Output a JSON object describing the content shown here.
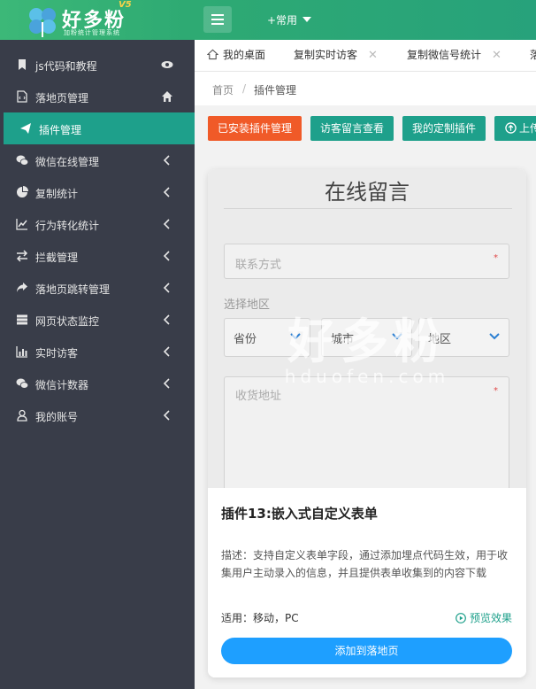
{
  "header": {
    "logo_title": "好多粉",
    "logo_version": "V5",
    "logo_subtitle": "加粉统计管理系统",
    "quick_menu": "+常用"
  },
  "sidebar": {
    "items": [
      {
        "label": "js代码和教程",
        "icon": "bookmark-icon",
        "right": "eye-icon"
      },
      {
        "label": "落地页管理",
        "icon": "code-file-icon",
        "right": "home-icon"
      },
      {
        "label": "插件管理",
        "icon": "paper-plane-icon",
        "right": "",
        "active": true
      },
      {
        "label": "微信在线管理",
        "icon": "wechat-icon",
        "right": "chevron-left-icon"
      },
      {
        "label": "复制统计",
        "icon": "pie-chart-icon",
        "right": "chevron-left-icon"
      },
      {
        "label": "行为转化统计",
        "icon": "line-chart-icon",
        "right": "chevron-left-icon"
      },
      {
        "label": "拦截管理",
        "icon": "exchange-icon",
        "right": "chevron-left-icon"
      },
      {
        "label": "落地页跳转管理",
        "icon": "share-icon",
        "right": "chevron-left-icon"
      },
      {
        "label": "网页状态监控",
        "icon": "server-icon",
        "right": "chevron-left-icon"
      },
      {
        "label": "实时访客",
        "icon": "bar-chart-icon",
        "right": "chevron-left-icon"
      },
      {
        "label": "微信计数器",
        "icon": "wechat-icon",
        "right": "chevron-left-icon"
      },
      {
        "label": "我的账号",
        "icon": "user-icon",
        "right": "chevron-left-icon"
      }
    ]
  },
  "tabs": [
    {
      "label": "我的桌面"
    },
    {
      "label": "复制实时访客"
    },
    {
      "label": "复制微信号统计"
    },
    {
      "label": "落"
    }
  ],
  "tab_close": "✕",
  "breadcrumb": {
    "home": "首页",
    "separator": "/",
    "current": "插件管理"
  },
  "actions": {
    "installed": "已安装插件管理",
    "messages": "访客留言查看",
    "custom": "我的定制插件",
    "upload": "上传"
  },
  "colors": {
    "header": "#2eaa73",
    "sidebar": "#393d49",
    "active": "#1ea08b",
    "danger": "#f05a28",
    "primary": "#1e9fff"
  },
  "preview": {
    "title": "在线留言",
    "contact_placeholder": "联系方式",
    "region_label": "选择地区",
    "province": "省份",
    "city": "城市",
    "district": "地区",
    "address_placeholder": "收货地址",
    "required_mark": "*",
    "watermark": "好多粉",
    "watermark_sub": "hduofen.com"
  },
  "card": {
    "title": "插件13:嵌入式自定义表单",
    "desc": "描述：支持自定义表单字段，通过添加埋点代码生效，用于收集用户主动录入的信息，并且提供表单收集到的内容下载",
    "apply": "适用：移动，PC",
    "preview_link": "预览效果",
    "add_button": "添加到落地页"
  }
}
